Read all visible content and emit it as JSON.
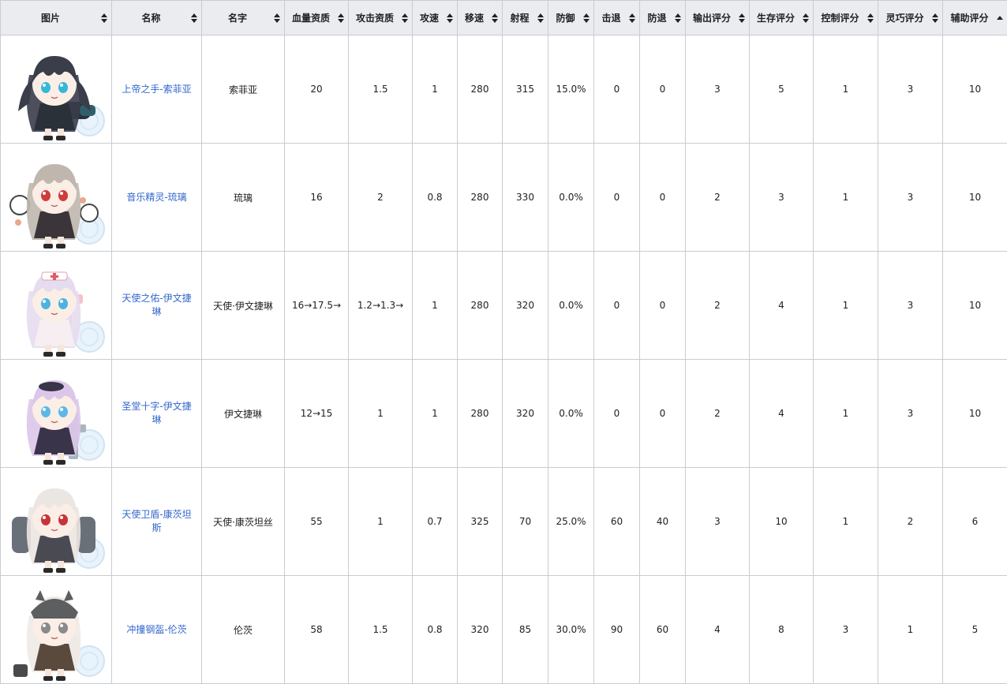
{
  "columns": [
    {
      "label": "图片",
      "sort": "both"
    },
    {
      "label": "名称",
      "sort": "both"
    },
    {
      "label": "名字",
      "sort": "both"
    },
    {
      "label": "血量资质",
      "sort": "both"
    },
    {
      "label": "攻击资质",
      "sort": "both"
    },
    {
      "label": "攻速",
      "sort": "both"
    },
    {
      "label": "移速",
      "sort": "both"
    },
    {
      "label": "射程",
      "sort": "both"
    },
    {
      "label": "防御",
      "sort": "both"
    },
    {
      "label": "击退",
      "sort": "both"
    },
    {
      "label": "防退",
      "sort": "both"
    },
    {
      "label": "输出评分",
      "sort": "both"
    },
    {
      "label": "生存评分",
      "sort": "both"
    },
    {
      "label": "控制评分",
      "sort": "both"
    },
    {
      "label": "灵巧评分",
      "sort": "both"
    },
    {
      "label": "辅助评分",
      "sort": "asc"
    }
  ],
  "rows": [
    {
      "image": "sophia-portrait",
      "title": "上帝之手-索菲亚",
      "name": "索菲亚",
      "hp": "20",
      "atk": "1.5",
      "aspd": "1",
      "mspd": "280",
      "range": "315",
      "def": "15.0%",
      "kb": "0",
      "kbres": "0",
      "dmg": "3",
      "surv": "5",
      "ctrl": "1",
      "agil": "3",
      "supp": "10"
    },
    {
      "image": "liuli-portrait",
      "title": "音乐精灵-琉璃",
      "name": "琉璃",
      "hp": "16",
      "atk": "2",
      "aspd": "0.8",
      "mspd": "280",
      "range": "330",
      "def": "0.0%",
      "kb": "0",
      "kbres": "0",
      "dmg": "2",
      "surv": "3",
      "ctrl": "1",
      "agil": "3",
      "supp": "10"
    },
    {
      "image": "angel-evangeline-portrait",
      "title": "天使之佑-伊文捷琳",
      "name": "天使·伊文捷琳",
      "hp": "16→17.5→",
      "atk": "1.2→1.3→",
      "aspd": "1",
      "mspd": "280",
      "range": "320",
      "def": "0.0%",
      "kb": "0",
      "kbres": "0",
      "dmg": "2",
      "surv": "4",
      "ctrl": "1",
      "agil": "3",
      "supp": "10"
    },
    {
      "image": "evangeline-portrait",
      "title": "圣堂十字-伊文捷琳",
      "name": "伊文捷琳",
      "hp": "12→15",
      "atk": "1",
      "aspd": "1",
      "mspd": "280",
      "range": "320",
      "def": "0.0%",
      "kb": "0",
      "kbres": "0",
      "dmg": "2",
      "surv": "4",
      "ctrl": "1",
      "agil": "3",
      "supp": "10"
    },
    {
      "image": "angel-constantine-portrait",
      "title": "天使卫盾-康茨坦斯",
      "name": "天使·康茨坦丝",
      "hp": "55",
      "atk": "1",
      "aspd": "0.7",
      "mspd": "325",
      "range": "70",
      "def": "25.0%",
      "kb": "60",
      "kbres": "40",
      "dmg": "3",
      "surv": "10",
      "ctrl": "1",
      "agil": "2",
      "supp": "6"
    },
    {
      "image": "renz-portrait",
      "title": "冲撞钢盔-伦茨",
      "name": "伦茨",
      "hp": "58",
      "atk": "1.5",
      "aspd": "0.8",
      "mspd": "320",
      "range": "85",
      "def": "30.0%",
      "kb": "90",
      "kbres": "60",
      "dmg": "4",
      "surv": "8",
      "ctrl": "3",
      "agil": "1",
      "supp": "5"
    }
  ],
  "chibi": [
    {
      "hair": "#3a3d4a",
      "eye": "#35b8d8",
      "outfit": "#2b3138",
      "accent": "#2f5f6a"
    },
    {
      "hair": "#bfb7ae",
      "eye": "#d03b3b",
      "outfit": "#3b3438",
      "accent": "#e06a3a"
    },
    {
      "hair": "#e6dcef",
      "eye": "#4ab3e0",
      "outfit": "#f7eef2",
      "accent": "#e37a8a"
    },
    {
      "hair": "#dcc7ea",
      "eye": "#5bb8e8",
      "outfit": "#3a344a",
      "accent": "#a9b6c0"
    },
    {
      "hair": "#ece6e2",
      "eye": "#c8343a",
      "outfit": "#4a4a52",
      "accent": "#6a7078"
    },
    {
      "hair": "#eeeae4",
      "eye": "#8a8a8a",
      "outfit": "#5a4a3e",
      "accent": "#5c5e60"
    }
  ]
}
